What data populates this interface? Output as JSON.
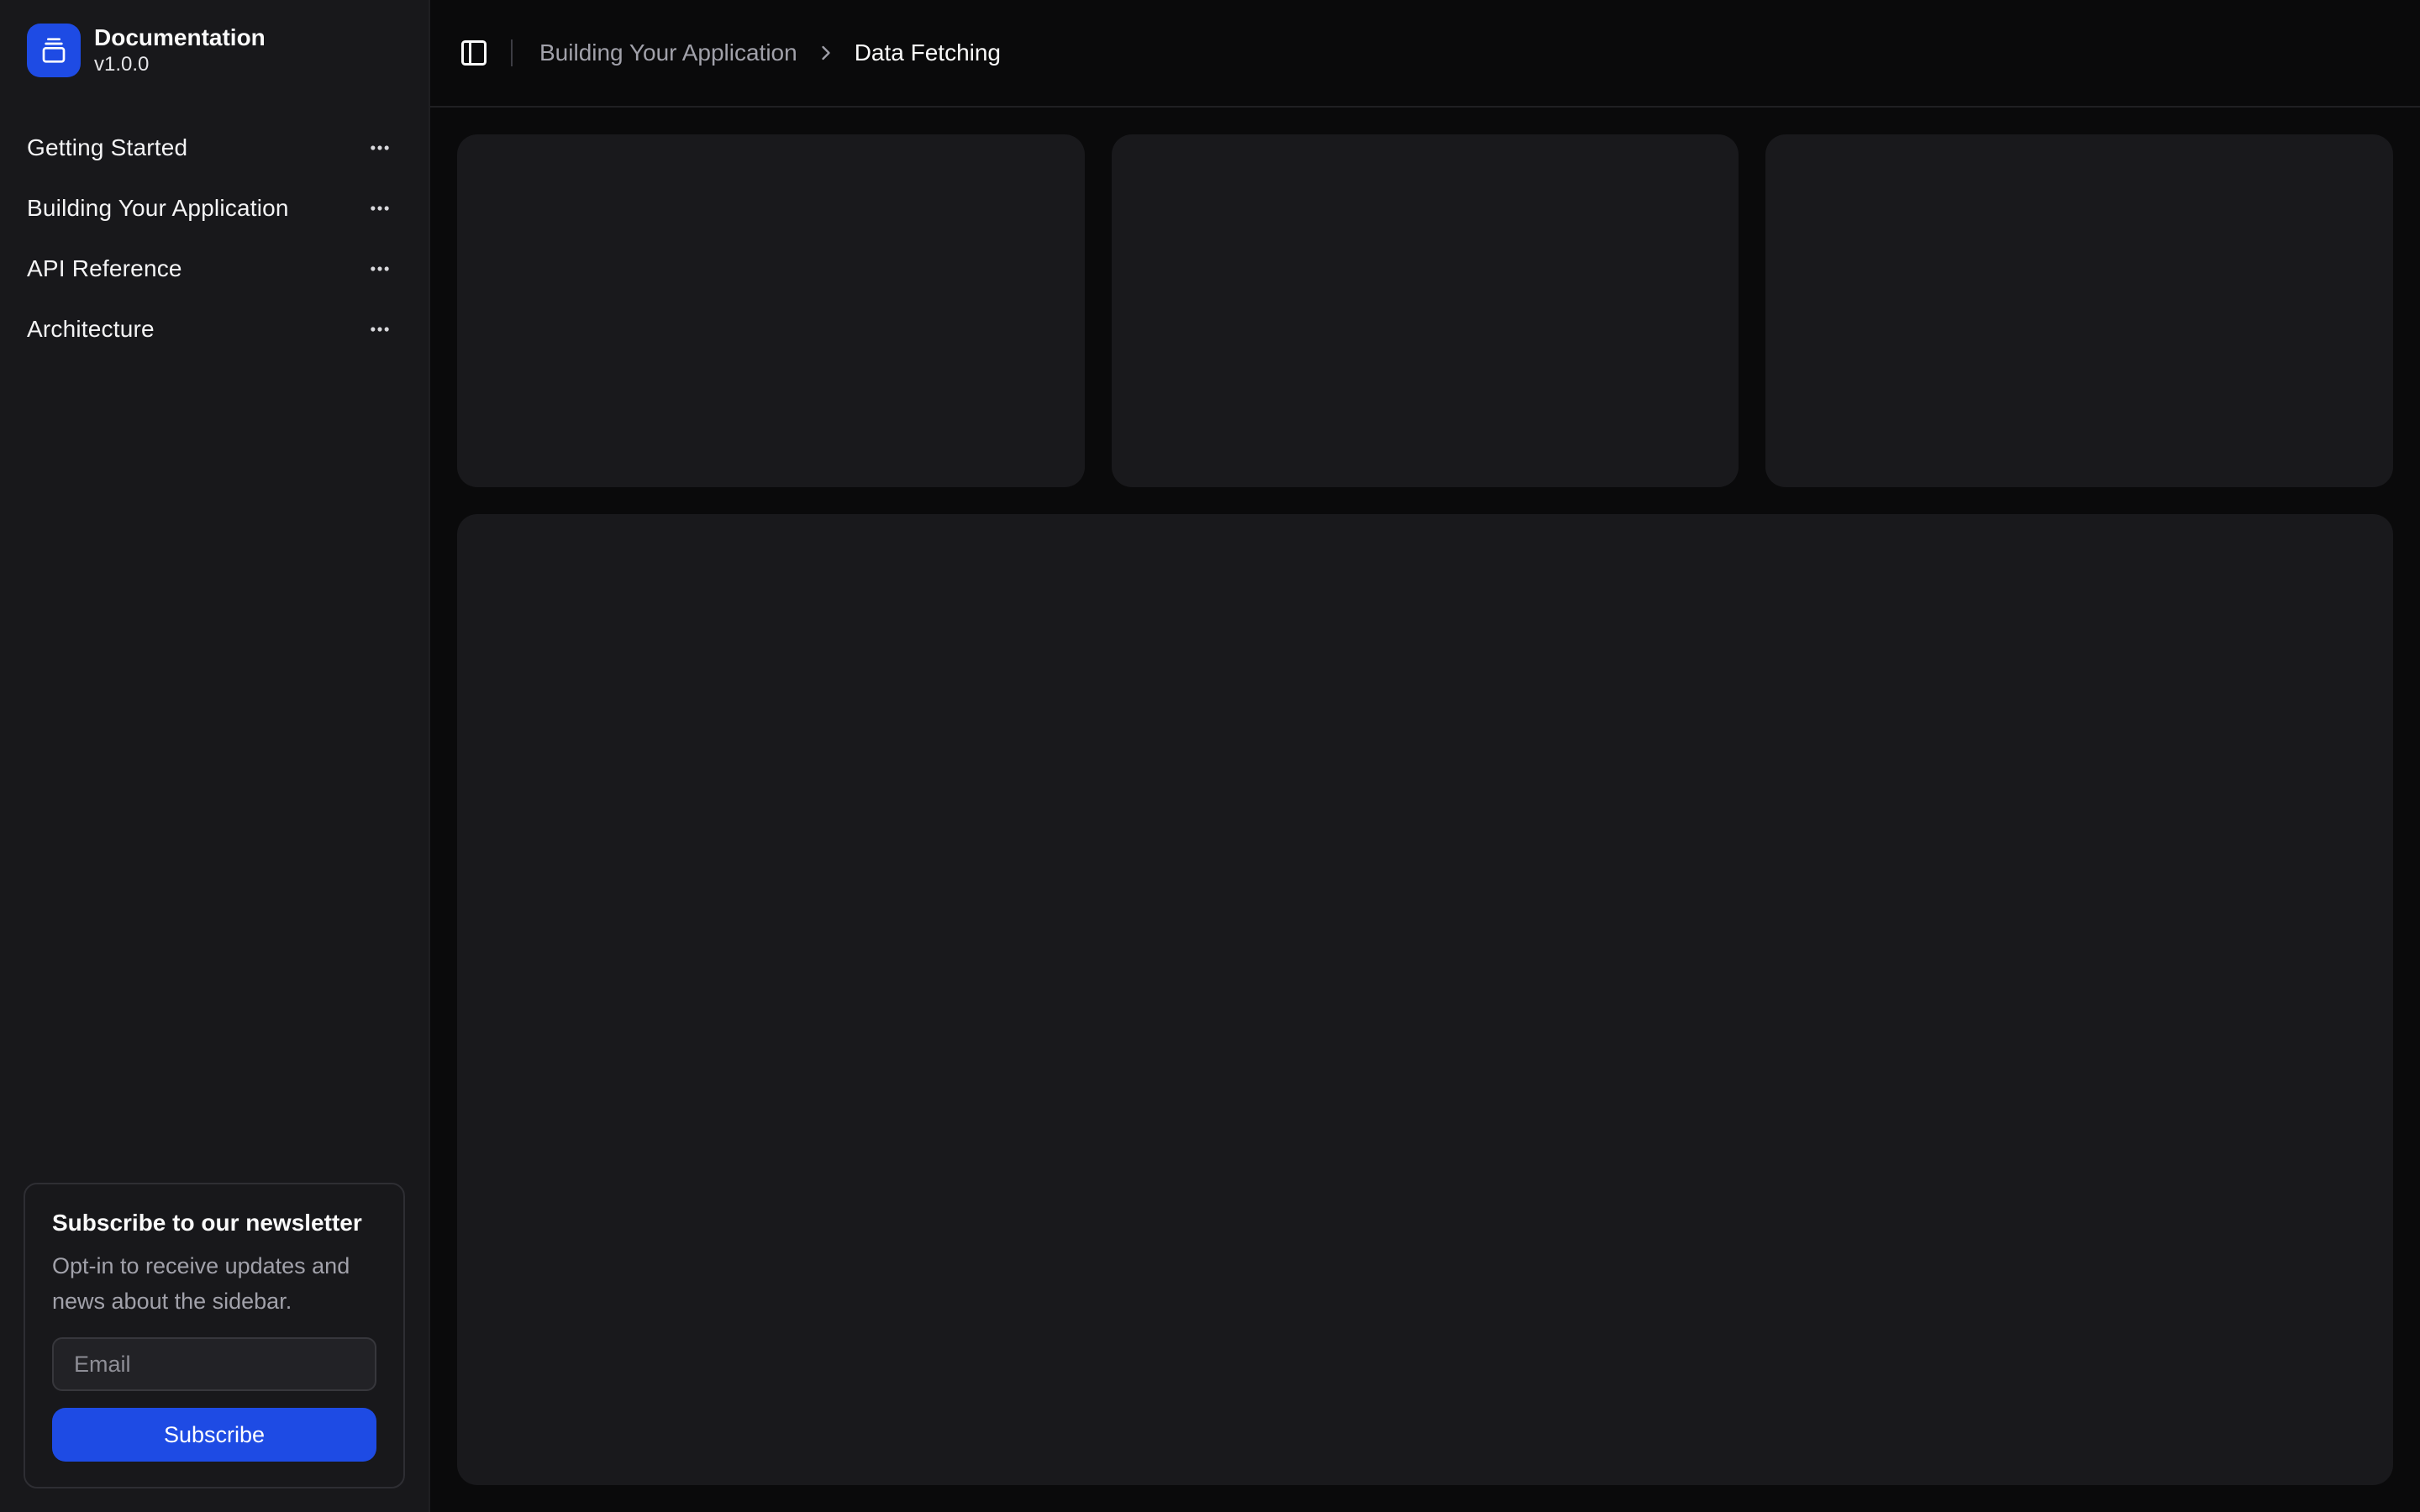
{
  "app": {
    "title": "Documentation",
    "version": "v1.0.0"
  },
  "sidebar": {
    "items": [
      {
        "label": "Getting Started"
      },
      {
        "label": "Building Your Application"
      },
      {
        "label": "API Reference"
      },
      {
        "label": "Architecture"
      }
    ],
    "newsletter": {
      "title": "Subscribe to our newsletter",
      "description": "Opt-in to receive updates and news about the sidebar.",
      "email_placeholder": "Email",
      "subscribe_label": "Subscribe"
    }
  },
  "header": {
    "breadcrumb_section": "Building Your Application",
    "breadcrumb_page": "Data Fetching"
  },
  "icons": {
    "logo": "gallery-vertical-end-icon",
    "menu_action": "ellipsis-icon",
    "sidebar_toggle": "panel-left-icon",
    "breadcrumb_separator": "chevron-right-icon"
  },
  "colors": {
    "accent_blue": "#1e4be4",
    "main_bg": "#0a0a0b",
    "sidebar_bg": "#18181b",
    "placeholder_card_bg": "#19191c",
    "border": "#2e2e33",
    "muted_text": "#a1a1aa"
  }
}
